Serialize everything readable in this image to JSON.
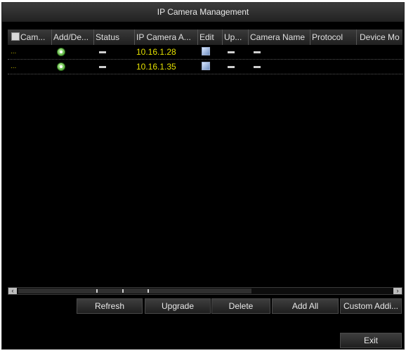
{
  "window": {
    "title": "IP Camera Management"
  },
  "table": {
    "columns": [
      "Cam...",
      "Add/De...",
      "Status",
      "IP Camera A...",
      "Edit",
      "Up...",
      "Camera Name",
      "Protocol",
      "Device Mo"
    ],
    "rows": [
      {
        "cam": "...",
        "ip": "10.16.1.28"
      },
      {
        "cam": "...",
        "ip": "10.16.1.35"
      }
    ]
  },
  "icons": {
    "add": "add-icon",
    "status": "dash-icon",
    "edit": "edit-icon",
    "scroll_left": "chevron-left-icon",
    "scroll_right": "chevron-right-icon"
  },
  "scroll": {
    "left_glyph": "‹",
    "right_glyph": "›"
  },
  "buttons": {
    "refresh": "Refresh",
    "upgrade": "Upgrade",
    "delete": "Delete",
    "add_all": "Add All",
    "custom_add": "Custom Addi...",
    "exit": "Exit"
  },
  "colors": {
    "ip_text": "#e3e000",
    "dots_text": "#b9b000",
    "background": "#000000"
  }
}
